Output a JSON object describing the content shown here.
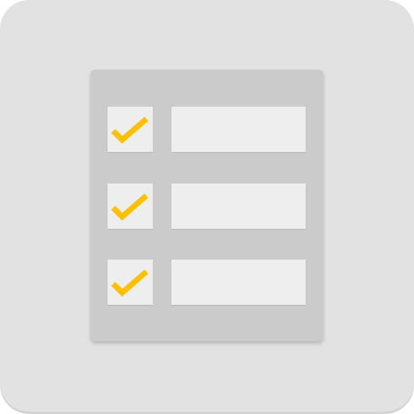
{
  "colors": {
    "icon_background": "#e2e2e2",
    "card_background": "#cbcbcb",
    "field_background": "#eeeeee",
    "checkmark": "#ffc000"
  },
  "checklist": {
    "items": [
      {
        "checked": true,
        "icon": "checkmark-icon"
      },
      {
        "checked": true,
        "icon": "checkmark-icon"
      },
      {
        "checked": true,
        "icon": "checkmark-icon"
      }
    ]
  }
}
